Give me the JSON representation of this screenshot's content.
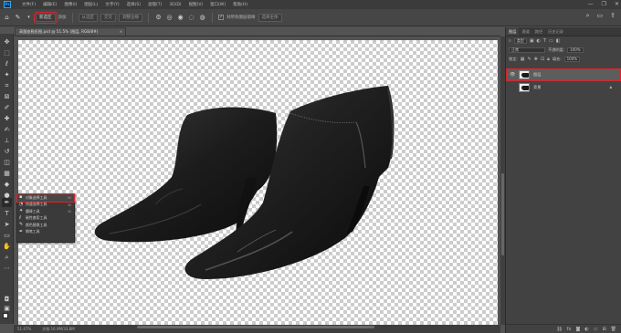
{
  "menubar": {
    "logo": "Ps",
    "items": [
      "文件(F)",
      "编辑(E)",
      "图像(I)",
      "图层(L)",
      "文字(Y)",
      "选择(S)",
      "滤镜(T)",
      "3D(D)",
      "视图(V)",
      "窗口(W)",
      "帮助(H)"
    ],
    "window_controls": [
      "—",
      "❐",
      "✕"
    ]
  },
  "options": {
    "new_selection": "新选区",
    "add": "添加",
    "subtract": "从选区",
    "intersect": "交叉",
    "refine": "调整边缘",
    "sample_all_layers": "对所有图层取样",
    "auto_enhance": "自动增强",
    "select_subject": "选择主体",
    "select_and_mask": "选择并遮住..."
  },
  "document": {
    "tab_title": "高跟皮鞋抠图.psd @ 51.5% (图层, RGB/8#)",
    "close": "×"
  },
  "flyout": {
    "items": [
      {
        "label": "对象选择工具",
        "key": "W",
        "icon": "object-select-icon"
      },
      {
        "label": "快速选择工具",
        "key": "W",
        "icon": "quick-select-icon"
      },
      {
        "label": "魔棒工具",
        "key": "W",
        "icon": "magic-wand-icon"
      },
      {
        "label": "磁性套索工具",
        "key": "",
        "icon": "magnetic-lasso-icon"
      },
      {
        "label": "颜色替换工具",
        "key": "",
        "icon": "color-replace-icon"
      },
      {
        "label": "钢笔工具",
        "key": "",
        "icon": "pen-icon"
      }
    ]
  },
  "status": {
    "zoom": "51.47%",
    "doc": "文档:16.9M/33.8M"
  },
  "panels": {
    "tabs": [
      "图层",
      "通道",
      "路径",
      "历史记录"
    ],
    "kind_label": "类型",
    "blend_mode": "正常",
    "opacity_label": "不透明度:",
    "opacity_value": "100%",
    "lock_label": "锁定:",
    "fill_label": "填充:",
    "fill_value": "100%",
    "layers": [
      {
        "name": "图层",
        "visible": true,
        "locked": false,
        "selected": true
      },
      {
        "name": "背景",
        "visible": false,
        "locked": true,
        "selected": false
      }
    ]
  },
  "colors": {
    "highlight": "#d9262a",
    "panel_bg": "#424242",
    "canvas_check": "#cccccc"
  }
}
